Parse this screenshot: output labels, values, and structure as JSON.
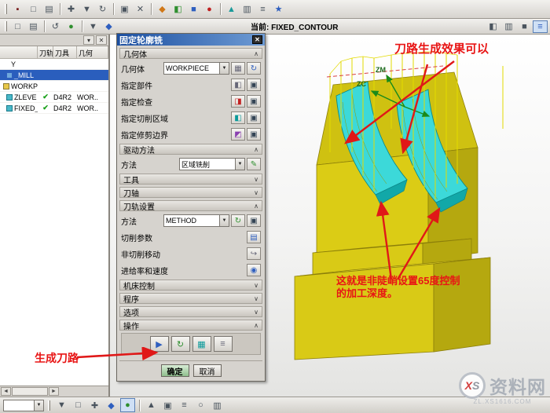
{
  "toolbars": {
    "top1": [
      "▪",
      "□",
      "▤",
      "✚",
      "▼",
      "↻",
      "▣",
      "✕",
      "◆",
      "◧",
      "■",
      "●",
      "▲",
      "▥",
      "≡",
      "★"
    ],
    "top2_left": [
      "□",
      "▤",
      "↺",
      "●",
      "▼",
      "◆"
    ],
    "current_label": "当前: FIXED_CONTOUR",
    "top2_right": [
      "◧",
      "▥",
      "■",
      "≡"
    ],
    "bottom": [
      "▼",
      "□",
      "✚",
      "◆",
      "●",
      "▲",
      "▣",
      "≡",
      "○",
      "▥"
    ]
  },
  "icons": {
    "close": "✕",
    "collapse": "▾",
    "dropdown": "▼",
    "scroll_left": "◄",
    "scroll_right": "►",
    "chev_up": "∧",
    "chev_down": "∨"
  },
  "navigator": {
    "columns": {
      "name": "",
      "path": "刀轨",
      "tool": "刀具",
      "geom": "几何"
    },
    "rows": [
      {
        "name": "Y",
        "check": "",
        "tool": "",
        "geom": ""
      },
      {
        "name": "_MILL",
        "check": "",
        "tool": "",
        "geom": ""
      },
      {
        "name": "WORKPIECE",
        "check": "",
        "tool": "",
        "geom": ""
      },
      {
        "name": "ZLEVE",
        "check": "✔",
        "tool": "D4R2",
        "geom": "WOR.."
      },
      {
        "name": "FIXED_",
        "check": "✔",
        "tool": "D4R2",
        "geom": "WOR.."
      }
    ]
  },
  "dialog": {
    "title": "固定轮廓铣",
    "sections": {
      "geometry": {
        "header": "几何体",
        "combo_label": "几何体",
        "combo_value": "WORKPIECE",
        "spec_rows": [
          {
            "label": "指定部件"
          },
          {
            "label": "指定检查"
          },
          {
            "label": "指定切削区域"
          },
          {
            "label": "指定修剪边界"
          }
        ]
      },
      "drive": {
        "header": "驱动方法",
        "label": "方法",
        "value": "区域铣削"
      },
      "tool": {
        "header": "工具"
      },
      "axis": {
        "header": "刀轴"
      },
      "path": {
        "header": "刀轨设置",
        "label": "方法",
        "value": "METHOD",
        "rows": [
          {
            "label": "切削参数"
          },
          {
            "label": "非切削移动"
          },
          {
            "label": "进给率和速度"
          }
        ]
      },
      "machine": {
        "header": "机床控制"
      },
      "program": {
        "header": "程序"
      },
      "options": {
        "header": "选项"
      },
      "actions": {
        "header": "操作"
      }
    },
    "ok": "确定",
    "cancel": "取消"
  },
  "glyphs": {
    "geo1": "▦",
    "geo2": "↻",
    "part1": "◧",
    "part2": "▣",
    "check1": "◨",
    "check2": "▣",
    "area1": "◧",
    "area2": "▣",
    "trim1": "◩",
    "trim2": "▣",
    "edit": "✎",
    "meth1": "↻",
    "meth2": "▣",
    "cut": "▤",
    "noncut": "↪",
    "feeds": "◉",
    "gen": "▶",
    "replay": "↻",
    "verify": "▦",
    "list": "≡"
  },
  "viewport": {
    "labels": {
      "zm": "ZM",
      "zc": "ZC"
    },
    "ann_top": "刀路生成效果可以",
    "ann_depth1": "这就是非陡峭设置65度控制",
    "ann_depth2": "的加工深度。",
    "ann_generate": "生成刀路"
  },
  "watermark": {
    "x": "X",
    "s": "S",
    "site": "资料网",
    "url": "ZL.XS1616.COM"
  },
  "colors": {
    "accent_red": "#e81515",
    "part_yellow": "#d9ca16",
    "machined_cyan": "#3cd9d9",
    "select_blue": "#2a5ebd"
  }
}
